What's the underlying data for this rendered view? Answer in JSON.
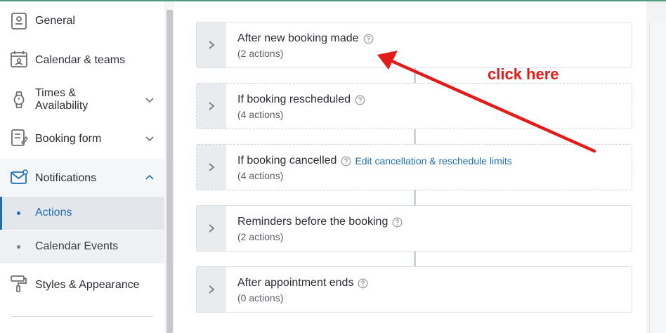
{
  "sidebar": {
    "items": [
      {
        "label": "General",
        "icon": "id-card-icon"
      },
      {
        "label": "Calendar & teams",
        "icon": "calendar-icon"
      },
      {
        "label": "Times &",
        "label2": "Availability",
        "icon": "watch-icon",
        "chevron": "down"
      },
      {
        "label": "Booking form",
        "icon": "form-icon",
        "chevron": "down"
      },
      {
        "label": "Notifications",
        "icon": "envelope-icon",
        "chevron": "up"
      },
      {
        "label": "Styles & Appearance",
        "icon": "paint-roller-icon"
      }
    ],
    "sub_items": [
      {
        "label": "Actions",
        "active": true
      },
      {
        "label": "Calendar Events",
        "active": false
      }
    ]
  },
  "cards": [
    {
      "title": "After new booking made",
      "count": "(2 actions)"
    },
    {
      "title": "If booking rescheduled",
      "count": "(4 actions)"
    },
    {
      "title": "If booking cancelled",
      "count": "(4 actions)",
      "link": "Edit cancellation & reschedule limits"
    },
    {
      "title": "Reminders before the booking",
      "count": "(2 actions)"
    },
    {
      "title": "After appointment ends",
      "count": "(0 actions)"
    }
  ],
  "annotation": {
    "text": "click here",
    "color": "#e41b1b"
  },
  "colors": {
    "accent": "#1f6fb5",
    "top_line": "#4f9a7c"
  }
}
